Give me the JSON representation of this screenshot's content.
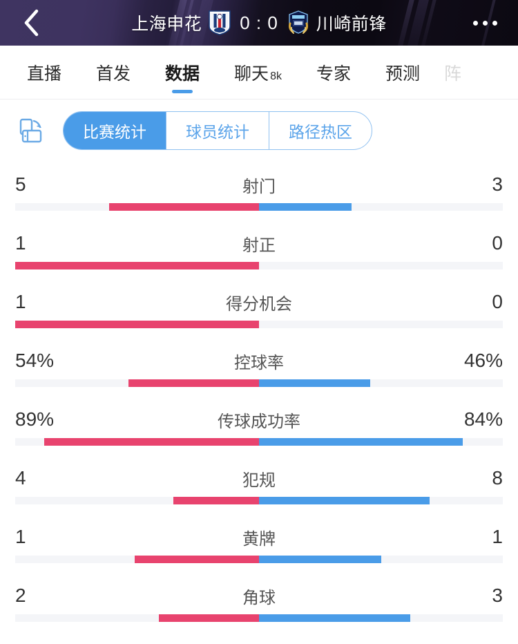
{
  "header": {
    "back_icon": "chevron-left-icon",
    "home_team": "上海申花",
    "away_team": "川崎前锋",
    "score": "0 : 0",
    "home_crest": "shanghai-shenhua-crest",
    "away_crest": "kawasaki-frontale-crest",
    "more_icon": "more-options-icon",
    "bg_color": "#0c0912",
    "accent_purple": "#3f3461"
  },
  "tabs": [
    {
      "label": "直播",
      "sub": "",
      "active": false
    },
    {
      "label": "首发",
      "sub": "",
      "active": false
    },
    {
      "label": "数据",
      "sub": "",
      "active": true
    },
    {
      "label": "聊天",
      "sub": "8k",
      "active": false
    },
    {
      "label": "专家",
      "sub": "",
      "active": false
    },
    {
      "label": "预测",
      "sub": "",
      "active": false
    },
    {
      "label": "阵",
      "sub": "",
      "active": false
    }
  ],
  "toolbar": {
    "rotate_icon": "screen-rotate-icon",
    "segments": [
      {
        "label": "比赛统计",
        "active": true
      },
      {
        "label": "球员统计",
        "active": false
      },
      {
        "label": "路径热区",
        "active": false
      }
    ]
  },
  "colors": {
    "home": "#e8436e",
    "away": "#4a9ce8",
    "track": "#f4f5f8",
    "active_tab_underline": "#4a9ce8"
  },
  "chart_data": {
    "type": "bar",
    "title": "比赛统计",
    "orientation": "diverging-horizontal",
    "legend": [
      {
        "name": "上海申花",
        "color": "#e8436e",
        "side": "left"
      },
      {
        "name": "川崎前锋",
        "color": "#4a9ce8",
        "side": "right"
      }
    ],
    "categories": [
      "射门",
      "射正",
      "得分机会",
      "控球率",
      "传球成功率",
      "犯规",
      "黄牌",
      "角球"
    ],
    "series": [
      {
        "name": "上海申花",
        "values": [
          5,
          1,
          1,
          54,
          89,
          4,
          1,
          2
        ]
      },
      {
        "name": "川崎前锋",
        "values": [
          3,
          0,
          0,
          46,
          84,
          8,
          1,
          3
        ]
      }
    ],
    "rows": [
      {
        "name": "射门",
        "home": "5",
        "away": "3",
        "home_pct": 61.5,
        "away_pct": 38.0
      },
      {
        "name": "射正",
        "home": "1",
        "away": "0",
        "home_pct": 100,
        "away_pct": 0
      },
      {
        "name": "得分机会",
        "home": "1",
        "away": "0",
        "home_pct": 100,
        "away_pct": 0
      },
      {
        "name": "控球率",
        "home": "54%",
        "away": "46%",
        "home_pct": 53.5,
        "away_pct": 45.5
      },
      {
        "name": "传球成功率",
        "home": "89%",
        "away": "84%",
        "home_pct": 88.0,
        "away_pct": 83.5
      },
      {
        "name": "犯规",
        "home": "4",
        "away": "8",
        "home_pct": 35.0,
        "away_pct": 70.0
      },
      {
        "name": "黄牌",
        "home": "1",
        "away": "1",
        "home_pct": 51.0,
        "away_pct": 50.0
      },
      {
        "name": "角球",
        "home": "2",
        "away": "3",
        "home_pct": 41.0,
        "away_pct": 62.0
      }
    ],
    "grid": false
  }
}
